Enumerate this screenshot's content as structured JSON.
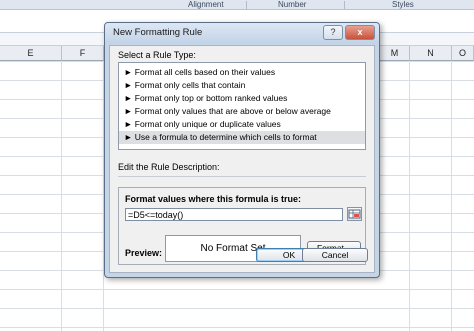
{
  "ribbon": {
    "groups": [
      "Alignment",
      "Number",
      "Styles"
    ]
  },
  "columns": [
    "E",
    "F",
    "",
    "",
    "",
    "",
    "",
    "",
    "M",
    "N",
    "O"
  ],
  "dialog": {
    "title": "New Formatting Rule",
    "help_label": "?",
    "close_label": "x",
    "select_rule_type_label": "Select a Rule Type:",
    "rule_types": [
      "► Format all cells based on their values",
      "► Format only cells that contain",
      "► Format only top or bottom ranked values",
      "► Format only values that are above or below average",
      "► Format only unique or duplicate values",
      "► Use a formula to determine which cells to format"
    ],
    "selected_rule_index": 5,
    "edit_description_label": "Edit the Rule Description:",
    "formula_label": "Format values where this formula is true:",
    "formula_value": "=D5<=today()",
    "preview_label": "Preview:",
    "preview_text": "No Format Set",
    "format_button": "Format...",
    "ok_button": "OK",
    "cancel_button": "Cancel"
  },
  "icons": {
    "range_picker": "range-picker-icon"
  }
}
